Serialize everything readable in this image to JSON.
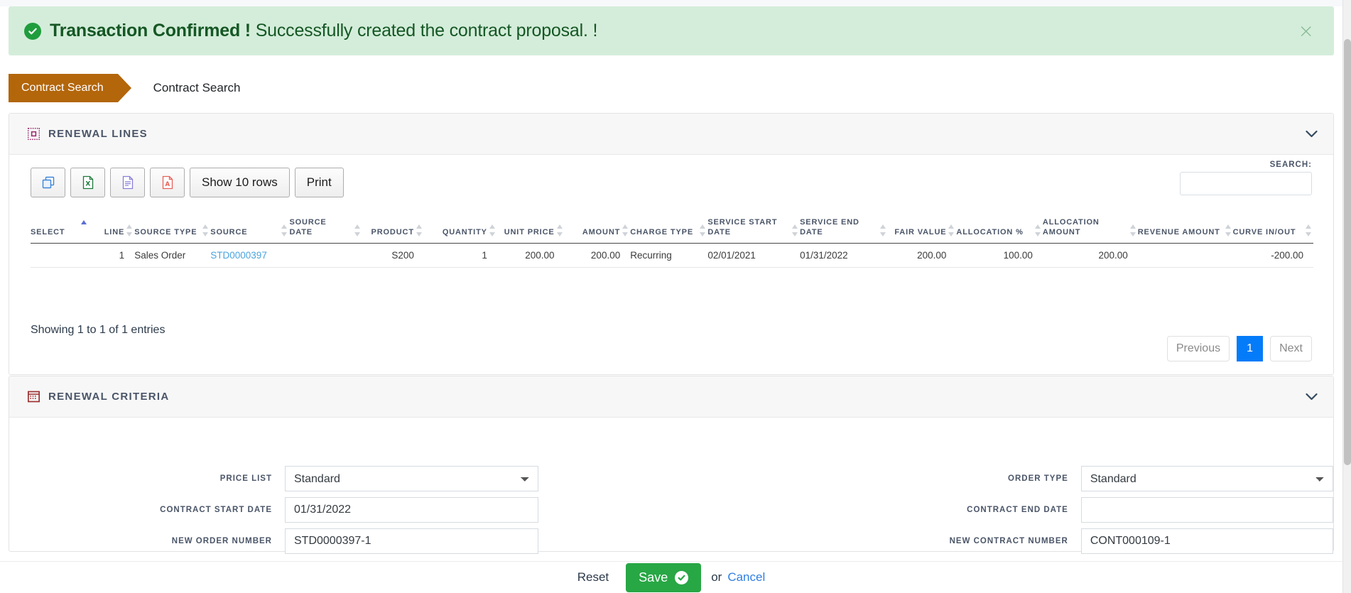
{
  "alert": {
    "icon": "check-circle-icon",
    "strong": "Transaction Confirmed !",
    "message": "Successfully created the contract proposal. !",
    "close_label": "×",
    "bg_color": "#d4edda",
    "text_color": "#155724",
    "icon_color": "#1f9d3d"
  },
  "breadcrumb": {
    "active": "Contract Search",
    "current": "Contract Search",
    "active_bg": "#b3660a"
  },
  "renewal_lines": {
    "icon": "grid-square-icon",
    "title": "RENEWAL LINES",
    "collapse_icon": "chevron-down-icon",
    "toolbar": [
      {
        "name": "copy-button",
        "icon": "copy-icon",
        "label": ""
      },
      {
        "name": "excel-export-button",
        "icon": "excel-icon",
        "label": ""
      },
      {
        "name": "csv-export-button",
        "icon": "document-icon",
        "label": ""
      },
      {
        "name": "pdf-export-button",
        "icon": "pdf-icon",
        "label": ""
      },
      {
        "name": "show-rows-button",
        "icon": "",
        "label": "Show 10 rows"
      },
      {
        "name": "print-button",
        "icon": "",
        "label": "Print"
      }
    ],
    "search": {
      "label": "SEARCH:",
      "value": "",
      "placeholder": ""
    },
    "columns": [
      {
        "label": "SELECT",
        "align": "left",
        "sort": "asc"
      },
      {
        "label": "LINE",
        "align": "right",
        "sort": "none"
      },
      {
        "label": "SOURCE TYPE",
        "align": "left",
        "sort": "none"
      },
      {
        "label": "SOURCE",
        "align": "left",
        "sort": "none"
      },
      {
        "label": "SOURCE DATE",
        "align": "left",
        "sort": "none"
      },
      {
        "label": "PRODUCT",
        "align": "right",
        "sort": "none"
      },
      {
        "label": "QUANTITY",
        "align": "right",
        "sort": "none"
      },
      {
        "label": "UNIT PRICE",
        "align": "right",
        "sort": "none"
      },
      {
        "label": "AMOUNT",
        "align": "right",
        "sort": "none"
      },
      {
        "label": "CHARGE TYPE",
        "align": "left",
        "sort": "none"
      },
      {
        "label": "SERVICE START DATE",
        "align": "left",
        "sort": "none"
      },
      {
        "label": "SERVICE END DATE",
        "align": "left",
        "sort": "none"
      },
      {
        "label": "FAIR VALUE",
        "align": "right",
        "sort": "none"
      },
      {
        "label": "ALLOCATION %",
        "align": "right",
        "sort": "none"
      },
      {
        "label": "ALLOCATION AMOUNT",
        "align": "right",
        "sort": "none"
      },
      {
        "label": "REVENUE AMOUNT",
        "align": "right",
        "sort": "none"
      },
      {
        "label": "CURVE IN/OUT",
        "align": "right",
        "sort": "none"
      }
    ],
    "rows": [
      {
        "select": "",
        "line": "1",
        "source_type": "Sales Order",
        "source": "STD0000397",
        "source_date": "",
        "product": "S200",
        "quantity": "1",
        "unit_price": "200.00",
        "amount": "200.00",
        "charge_type": "Recurring",
        "service_start_date": "02/01/2021",
        "service_end_date": "01/31/2022",
        "fair_value": "200.00",
        "allocation_pct": "100.00",
        "allocation_amount": "200.00",
        "revenue_amount": "",
        "curve_in_out": "-200.00"
      }
    ],
    "info": "Showing 1 to 1 of 1 entries",
    "pager": {
      "previous": "Previous",
      "pages": [
        "1"
      ],
      "next": "Next",
      "active_page": "1",
      "active_color": "#047bf8"
    }
  },
  "renewal_criteria": {
    "icon": "calendar-grid-icon",
    "title": "RENEWAL CRITERIA",
    "collapse_icon": "chevron-down-icon",
    "left_fields": [
      {
        "name": "price-list",
        "label": "PRICE LIST",
        "type": "select",
        "value": "Standard",
        "options": [
          "Standard"
        ]
      },
      {
        "name": "contract-start-date",
        "label": "CONTRACT START DATE",
        "type": "text",
        "value": "01/31/2022",
        "placeholder": ""
      },
      {
        "name": "new-order-number",
        "label": "NEW ORDER NUMBER",
        "type": "text",
        "value": "STD0000397-1",
        "placeholder": ""
      }
    ],
    "right_fields": [
      {
        "name": "order-type",
        "label": "ORDER TYPE",
        "type": "select",
        "value": "Standard",
        "options": [
          "Standard"
        ]
      },
      {
        "name": "contract-end-date",
        "label": "CONTRACT END DATE",
        "type": "text",
        "value": "",
        "placeholder": ""
      },
      {
        "name": "new-contract-number",
        "label": "NEW CONTRACT NUMBER",
        "type": "text",
        "value": "CONT000109-1",
        "placeholder": ""
      }
    ]
  },
  "actions": {
    "reset": "Reset",
    "save": "Save",
    "save_icon": "check-circle-icon",
    "or": "or",
    "cancel": "Cancel",
    "save_color": "#28a745",
    "cancel_color": "#2f7fe0"
  }
}
